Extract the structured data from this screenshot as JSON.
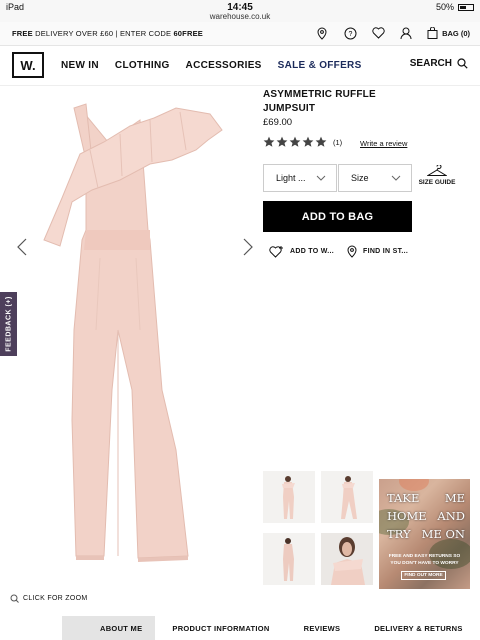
{
  "statusbar": {
    "carrier": "iPad",
    "time": "14:45",
    "url": "warehouse.co.uk",
    "battery": "50%",
    "battery_level": 0.5
  },
  "promo": {
    "free": "FREE",
    "text": " DELIVERY OVER £60 | ENTER CODE ",
    "code": "60FREE"
  },
  "utils": {
    "bag_label": "BAG (0)"
  },
  "logo": "W.",
  "nav": {
    "items": [
      "NEW IN",
      "CLOTHING",
      "ACCESSORIES",
      "SALE & OFFERS"
    ],
    "search": "SEARCH"
  },
  "product": {
    "name": "ASYMMETRIC RUFFLE JUMPSUIT",
    "price": "£69.00",
    "rating": 5,
    "rating_count": "(1)",
    "write_review": "Write a review",
    "colour_select": "Light ...",
    "size_select": "Size",
    "size_guide": "SIZE GUIDE",
    "add_to_bag": "ADD TO BAG",
    "add_to_wishlist": "ADD TO W...",
    "find_in_store": "FIND IN ST..."
  },
  "feedback": "FEEDBACK (+)",
  "zoom": "CLICK FOR ZOOM",
  "takeme": {
    "line1": [
      "TAKE",
      "ME"
    ],
    "line2": [
      "HOME",
      "AND"
    ],
    "line3": [
      "TRY",
      "ME ON"
    ],
    "sub": "FREE AND EASY RETURNS SO YOU DON'T HAVE TO WORRY",
    "cta": "FIND OUT MORE"
  },
  "tabs": [
    "ABOUT ME",
    "PRODUCT INFORMATION",
    "REVIEWS",
    "DELIVERY & RETURNS"
  ],
  "colors": {
    "product": "#f2d2c8",
    "sale": "#1b2a5a",
    "feedback": "#4d3f5b"
  }
}
